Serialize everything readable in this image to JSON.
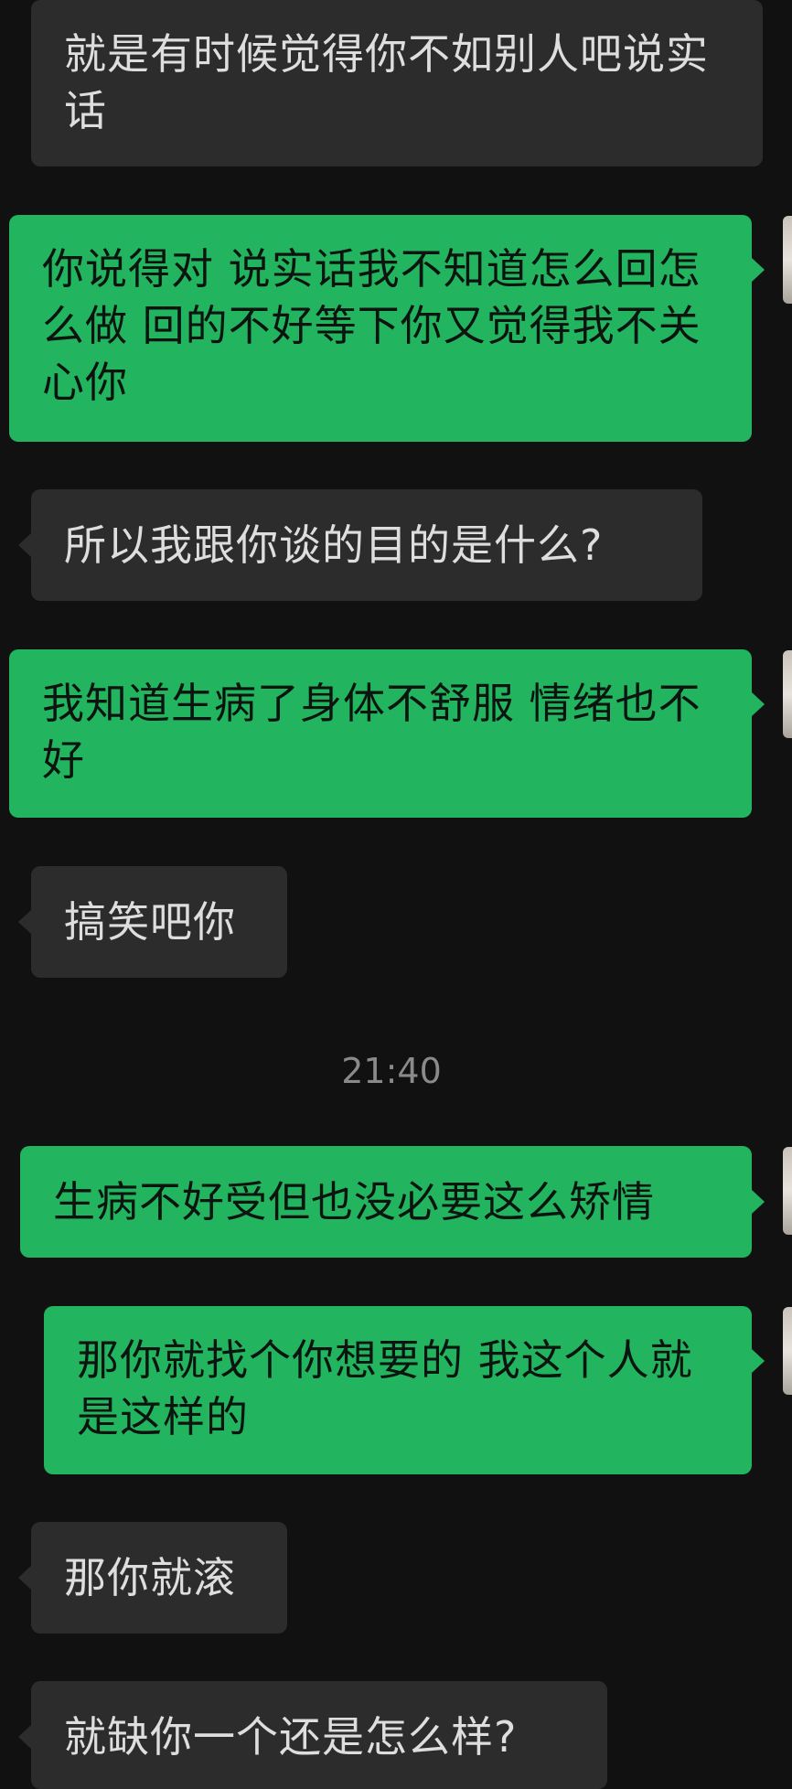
{
  "messages": [
    {
      "side": "in",
      "text": "就是有时候觉得你不如别人吧说实话"
    },
    {
      "side": "out",
      "text": "你说得对 说实话我不知道怎么回怎么做  回的不好等下你又觉得我不关心你"
    },
    {
      "side": "in",
      "text": "所以我跟你谈的目的是什么?"
    },
    {
      "side": "out",
      "text": "我知道生病了身体不舒服 情绪也不好"
    },
    {
      "side": "in",
      "text": "搞笑吧你"
    },
    {
      "side": "out",
      "text": "生病不好受但也没必要这么矫情"
    },
    {
      "side": "out",
      "text": "那你就找个你想要的  我这个人就是这样的"
    },
    {
      "side": "in",
      "text": "那你就滚"
    },
    {
      "side": "in",
      "text": "就缺你一个还是怎么样?"
    }
  ],
  "timestamp": "21:40",
  "colors": {
    "background": "#111111",
    "incoming_bubble": "#2c2c2c",
    "outgoing_bubble": "#23b45f",
    "timestamp_text": "#8a8a8a"
  }
}
